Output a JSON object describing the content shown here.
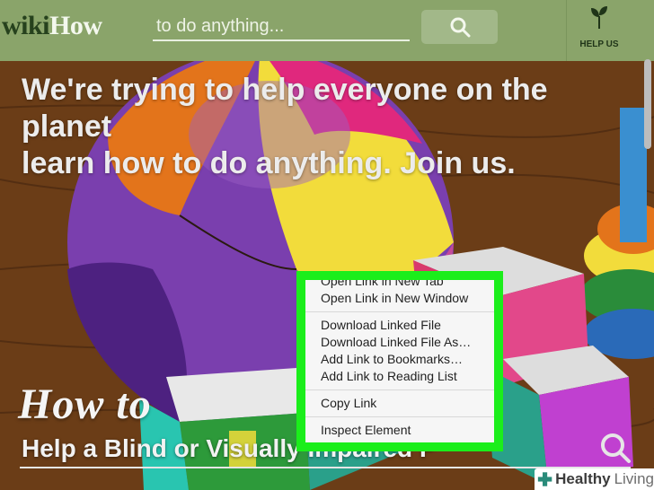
{
  "header": {
    "logo_wiki": "wiki",
    "logo_how": "How",
    "search_placeholder": "to do anything...",
    "search_icon": "search-icon",
    "help_label": "HELP US",
    "help_icon": "sprout-icon"
  },
  "hero": {
    "line1": "We're trying to help everyone on the planet",
    "line2": "learn how to do anything. Join us."
  },
  "featured": {
    "kicker": "How to",
    "title": "Help a Blind or Visually Impaired P"
  },
  "context_menu": {
    "groups": [
      [
        "Open Link in New Tab",
        "Open Link in New Window"
      ],
      [
        "Download Linked File",
        "Download Linked File As…",
        "Add Link to Bookmarks…",
        "Add Link to Reading List"
      ],
      [
        "Copy Link"
      ],
      [
        "Inspect Element"
      ]
    ],
    "highlight_color": "#1bee1b"
  },
  "badge": {
    "icon": "cross-icon",
    "text_bold": "Healthy",
    "text": "Living"
  },
  "colors": {
    "header_bg": "#8aa46a",
    "accent": "#1bee1b"
  }
}
